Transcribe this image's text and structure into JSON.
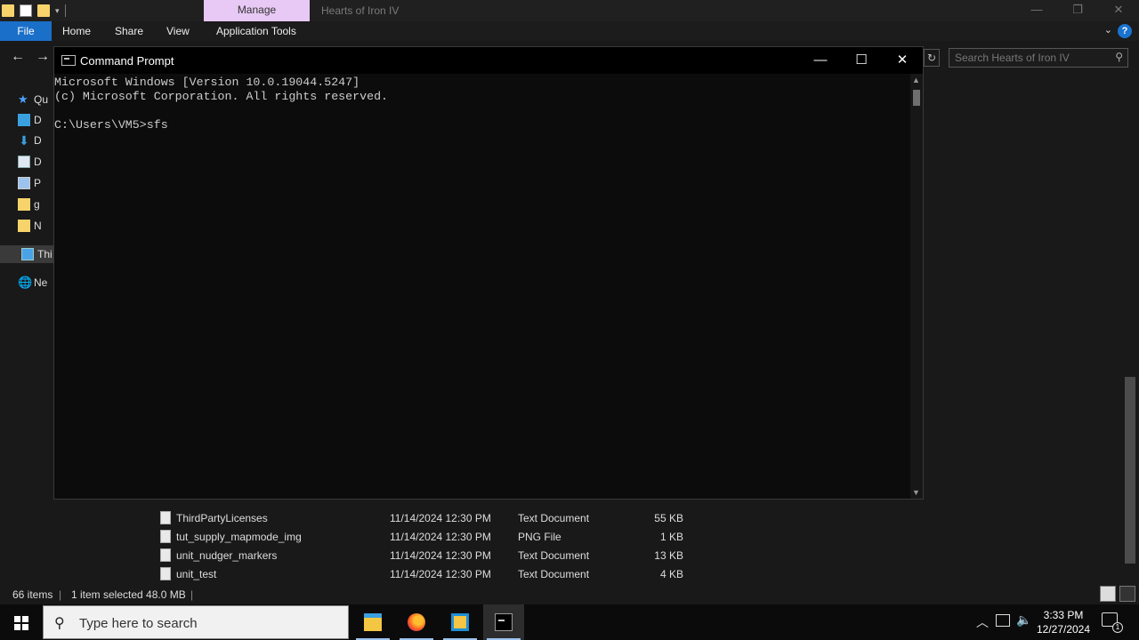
{
  "explorer": {
    "ribbon_context_tab": "Manage",
    "window_title": "Hearts of Iron IV",
    "tabs": [
      "File",
      "Home",
      "Share",
      "View",
      "Application Tools"
    ],
    "search_placeholder": "Search Hearts of Iron IV",
    "nav_items": [
      {
        "label": "Qu",
        "icon": "star-icon"
      },
      {
        "label": "D",
        "icon": "desktop-icon"
      },
      {
        "label": "D",
        "icon": "download-icon"
      },
      {
        "label": "D",
        "icon": "document-icon"
      },
      {
        "label": "P",
        "icon": "pictures-icon"
      },
      {
        "label": "g",
        "icon": "folder-icon"
      },
      {
        "label": "N",
        "icon": "folder-icon"
      },
      {
        "label": "Thi",
        "icon": "computer-icon"
      },
      {
        "label": "Ne",
        "icon": "network-icon"
      }
    ],
    "files": [
      {
        "name": "ThirdPartyLicenses",
        "date": "11/14/2024 12:30 PM",
        "type": "Text Document",
        "size": "55 KB"
      },
      {
        "name": "tut_supply_mapmode_img",
        "date": "11/14/2024 12:30 PM",
        "type": "PNG File",
        "size": "1 KB"
      },
      {
        "name": "unit_nudger_markers",
        "date": "11/14/2024 12:30 PM",
        "type": "Text Document",
        "size": "13 KB"
      },
      {
        "name": "unit_test",
        "date": "11/14/2024 12:30 PM",
        "type": "Text Document",
        "size": "4 KB"
      }
    ],
    "status": {
      "item_count": "66 items",
      "selection": "1 item selected  48.0 MB"
    }
  },
  "cmd": {
    "title": "Command Prompt",
    "lines": [
      "Microsoft Windows [Version 10.0.19044.5247]",
      "(c) Microsoft Corporation. All rights reserved.",
      "",
      "C:\\Users\\VM5>sfs"
    ]
  },
  "taskbar": {
    "search_placeholder": "Type here to search",
    "time": "3:33 PM",
    "date": "12/27/2024",
    "notification_count": "1",
    "apps": [
      {
        "name": "file-explorer",
        "icon": "file-explorer-icon"
      },
      {
        "name": "firefox",
        "icon": "firefox-icon"
      },
      {
        "name": "virtualbox",
        "icon": "virtualbox-icon"
      },
      {
        "name": "command-prompt",
        "icon": "command-prompt-icon",
        "active": true
      }
    ]
  },
  "colors": {
    "accent": "#1a6fc8",
    "manage_tab": "#e8c8f5",
    "console_bg": "#0c0c0c",
    "console_text": "#cccccc"
  }
}
